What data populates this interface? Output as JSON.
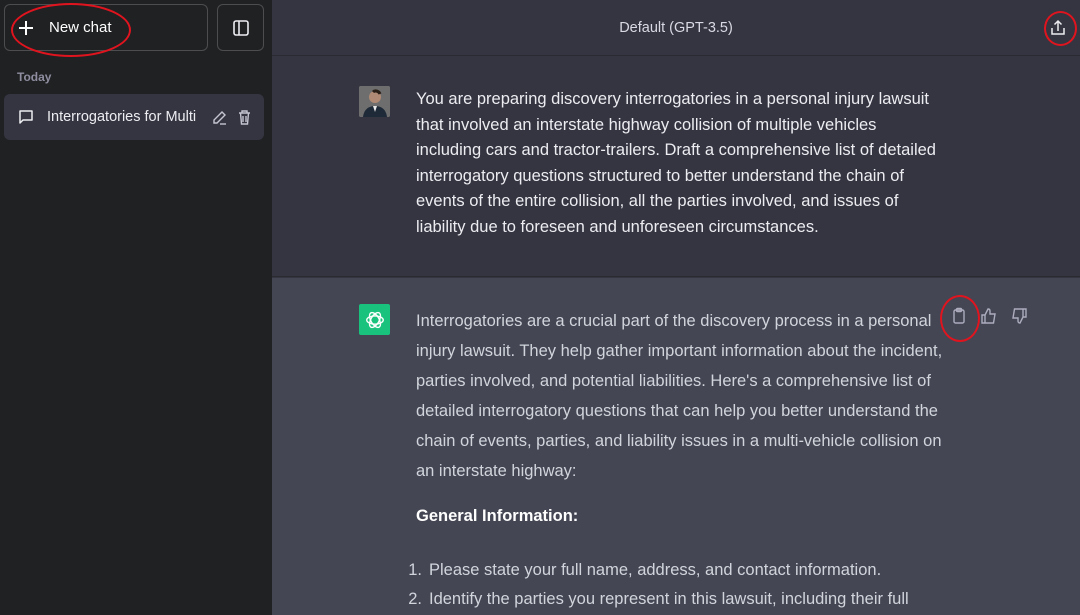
{
  "sidebar": {
    "new_chat_label": "New chat",
    "section_label": "Today",
    "chats": [
      {
        "title": "Interrogatories for Multi"
      }
    ]
  },
  "header": {
    "model_label": "Default (GPT-3.5)"
  },
  "conversation": {
    "user_message": "You are preparing discovery interrogatories in a personal injury lawsuit that involved an interstate highway collision of multiple vehicles including cars and tractor-trailers. Draft a comprehensive list of detailed interrogatory questions structured to better understand the chain of events of the entire collision, all the parties involved, and issues of liability due to foreseen and unforeseen circumstances.",
    "assistant_intro": "Interrogatories are a crucial part of the discovery process in a personal injury lawsuit. They help gather important information about the incident, parties involved, and potential liabilities. Here's a comprehensive list of detailed interrogatory questions that can help you better understand the chain of events, parties, and liability issues in a multi-vehicle collision on an interstate highway:",
    "assistant_heading": "General Information:",
    "assistant_list": [
      {
        "num": "1.",
        "text": "Please state your full name, address, and contact information."
      },
      {
        "num": "2.",
        "text": "Identify the parties you represent in this lawsuit, including their full"
      }
    ]
  },
  "icons": {
    "new_chat": "plus-icon",
    "sidebar_toggle": "sidebar-toggle-icon",
    "chat": "chat-bubble-icon",
    "edit": "pencil-icon",
    "delete": "trash-icon",
    "share": "share-icon",
    "copy": "clipboard-icon",
    "like": "thumbs-up-icon",
    "dislike": "thumbs-down-icon"
  },
  "colors": {
    "sidebar_bg": "#202123",
    "user_bg": "#343541",
    "assistant_bg": "#444654",
    "gpt_brand": "#19c37d",
    "annotation": "#e0141e"
  }
}
